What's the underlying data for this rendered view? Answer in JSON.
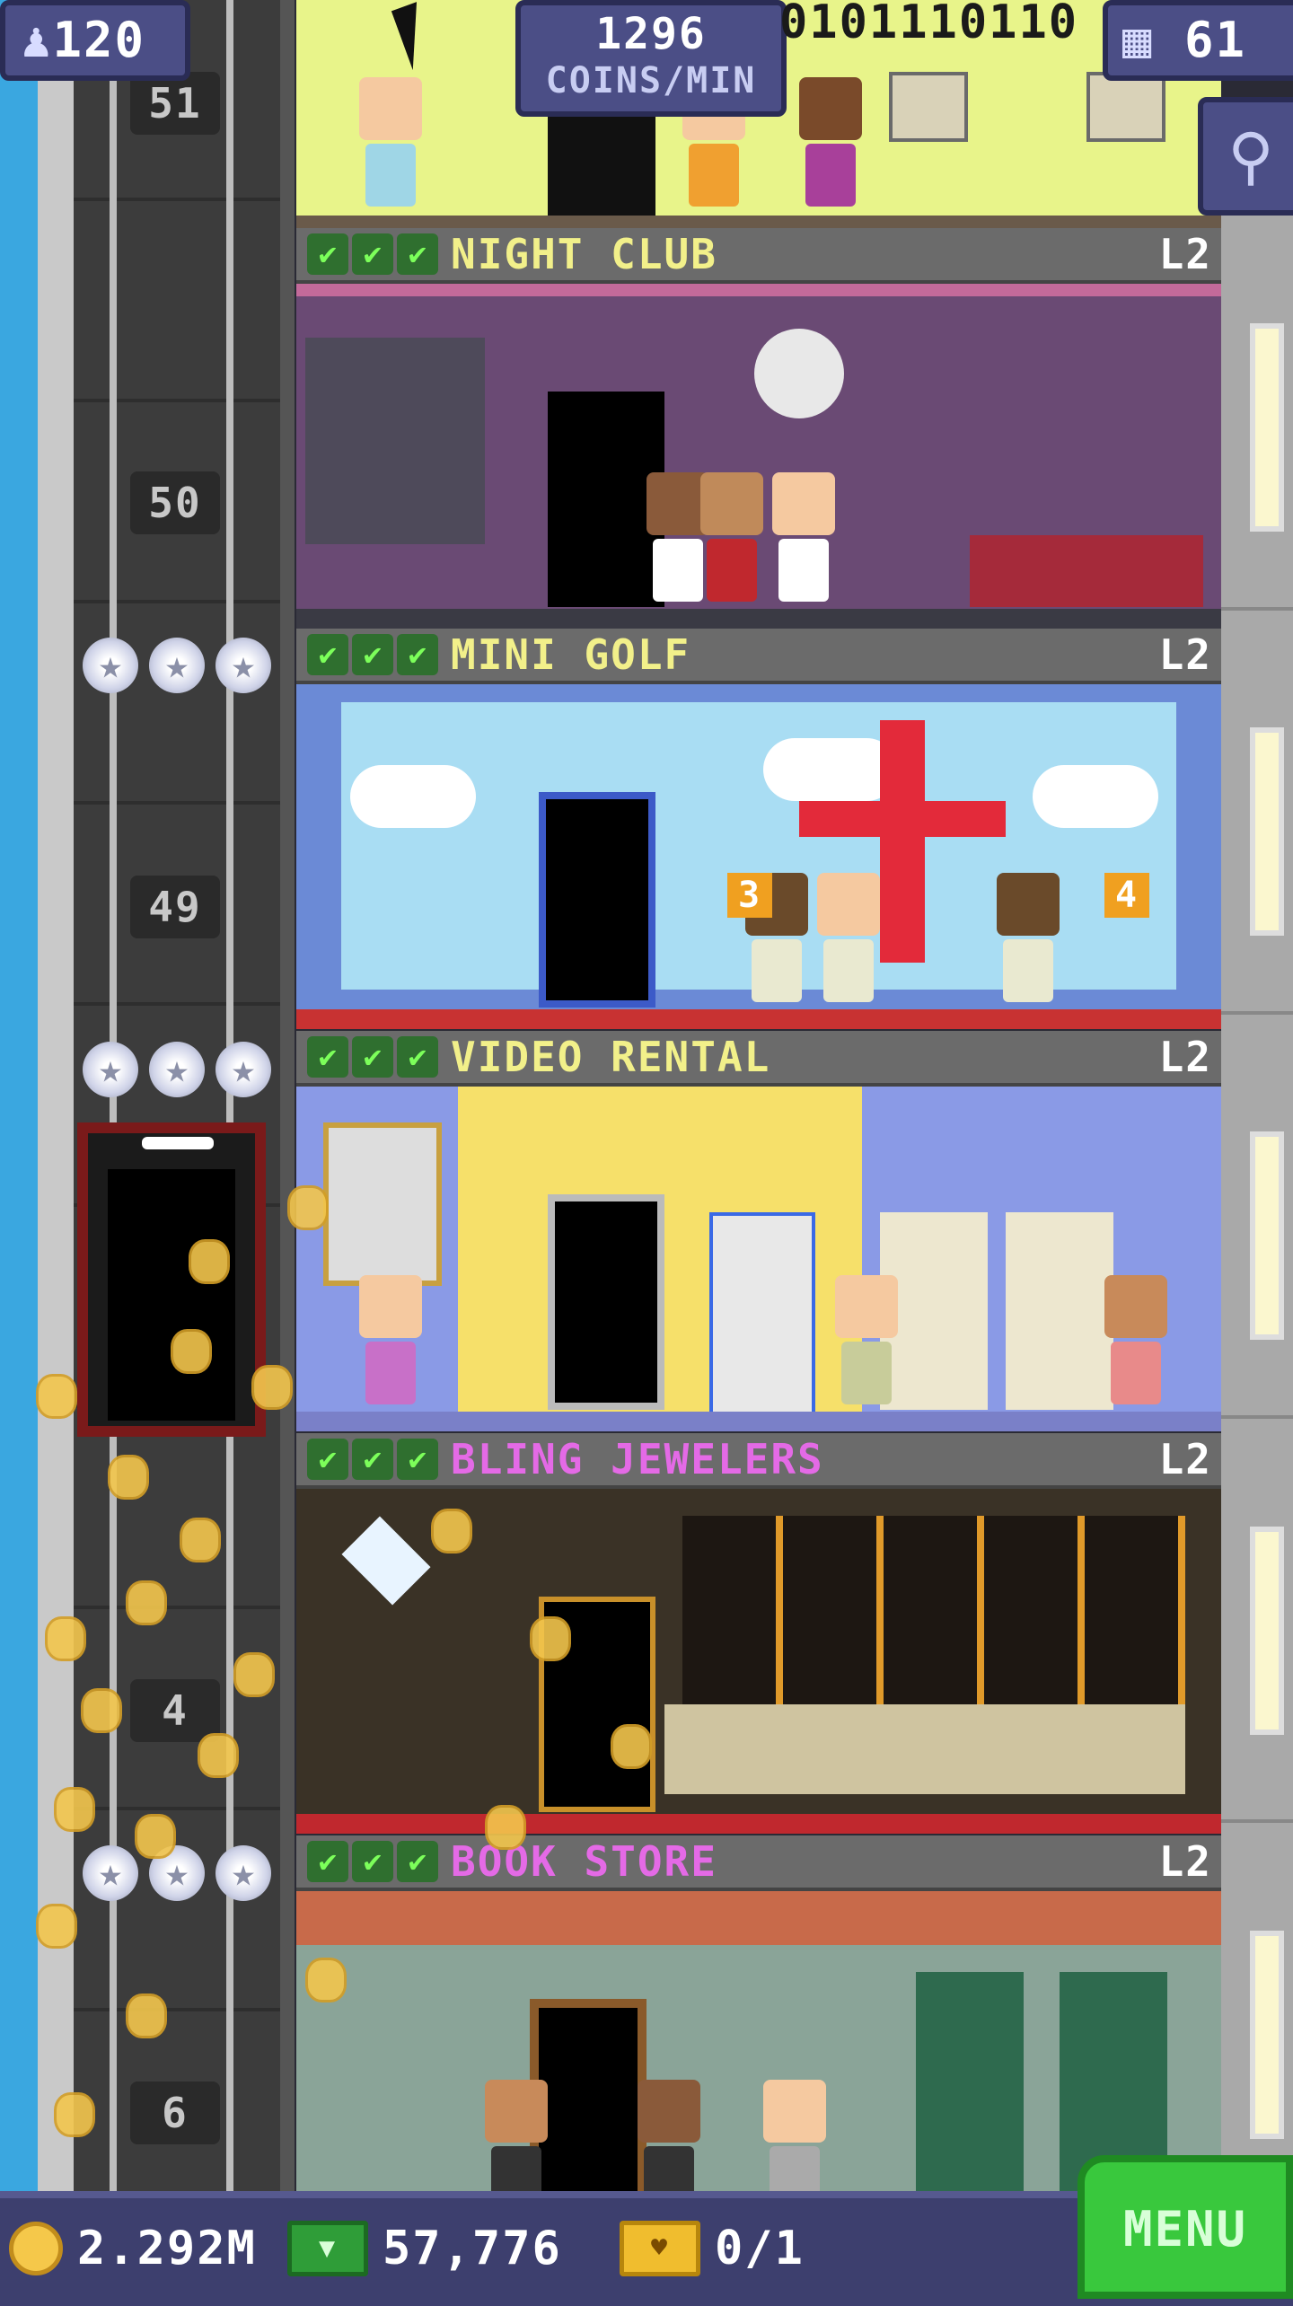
{
  "hud": {
    "population": "120",
    "coins_per_min": "1296",
    "coins_per_min_label": "COINS/MIN",
    "binary_readout": "0101110110",
    "floor_count": "61"
  },
  "elevator": {
    "floor_numbers": [
      "51",
      "50",
      "49",
      "4",
      "6"
    ]
  },
  "floors": [
    {
      "name": "NIGHT CLUB",
      "level": "L2",
      "name_color": "#f2f08a",
      "checks": 3
    },
    {
      "name": "MINI GOLF",
      "level": "L2",
      "name_color": "#f2f08a",
      "checks": 3
    },
    {
      "name": "VIDEO RENTAL",
      "level": "L2",
      "name_color": "#f2f08a",
      "checks": 3
    },
    {
      "name": "BLING JEWELERS",
      "level": "L2",
      "name_color": "#e46ae6",
      "checks": 3
    },
    {
      "name": "BOOK STORE",
      "level": "L2",
      "name_color": "#e46ae6",
      "checks": 3
    }
  ],
  "mini_golf": {
    "hole_left": "3",
    "hole_right": "4"
  },
  "bottom_bar": {
    "coins": "2.292M",
    "bux": "57,776",
    "tickets": "0/1",
    "menu_label": "MENU"
  },
  "colors": {
    "hud_bg": "#4b4e86",
    "menu_green": "#39c83d",
    "sky": "#3aa7e0"
  },
  "icons": [
    "person-icon",
    "building-icon",
    "magnifier-icon",
    "coin-icon",
    "bux-icon",
    "ticket-icon",
    "check-icon",
    "star-icon",
    "cursor-icon"
  ]
}
